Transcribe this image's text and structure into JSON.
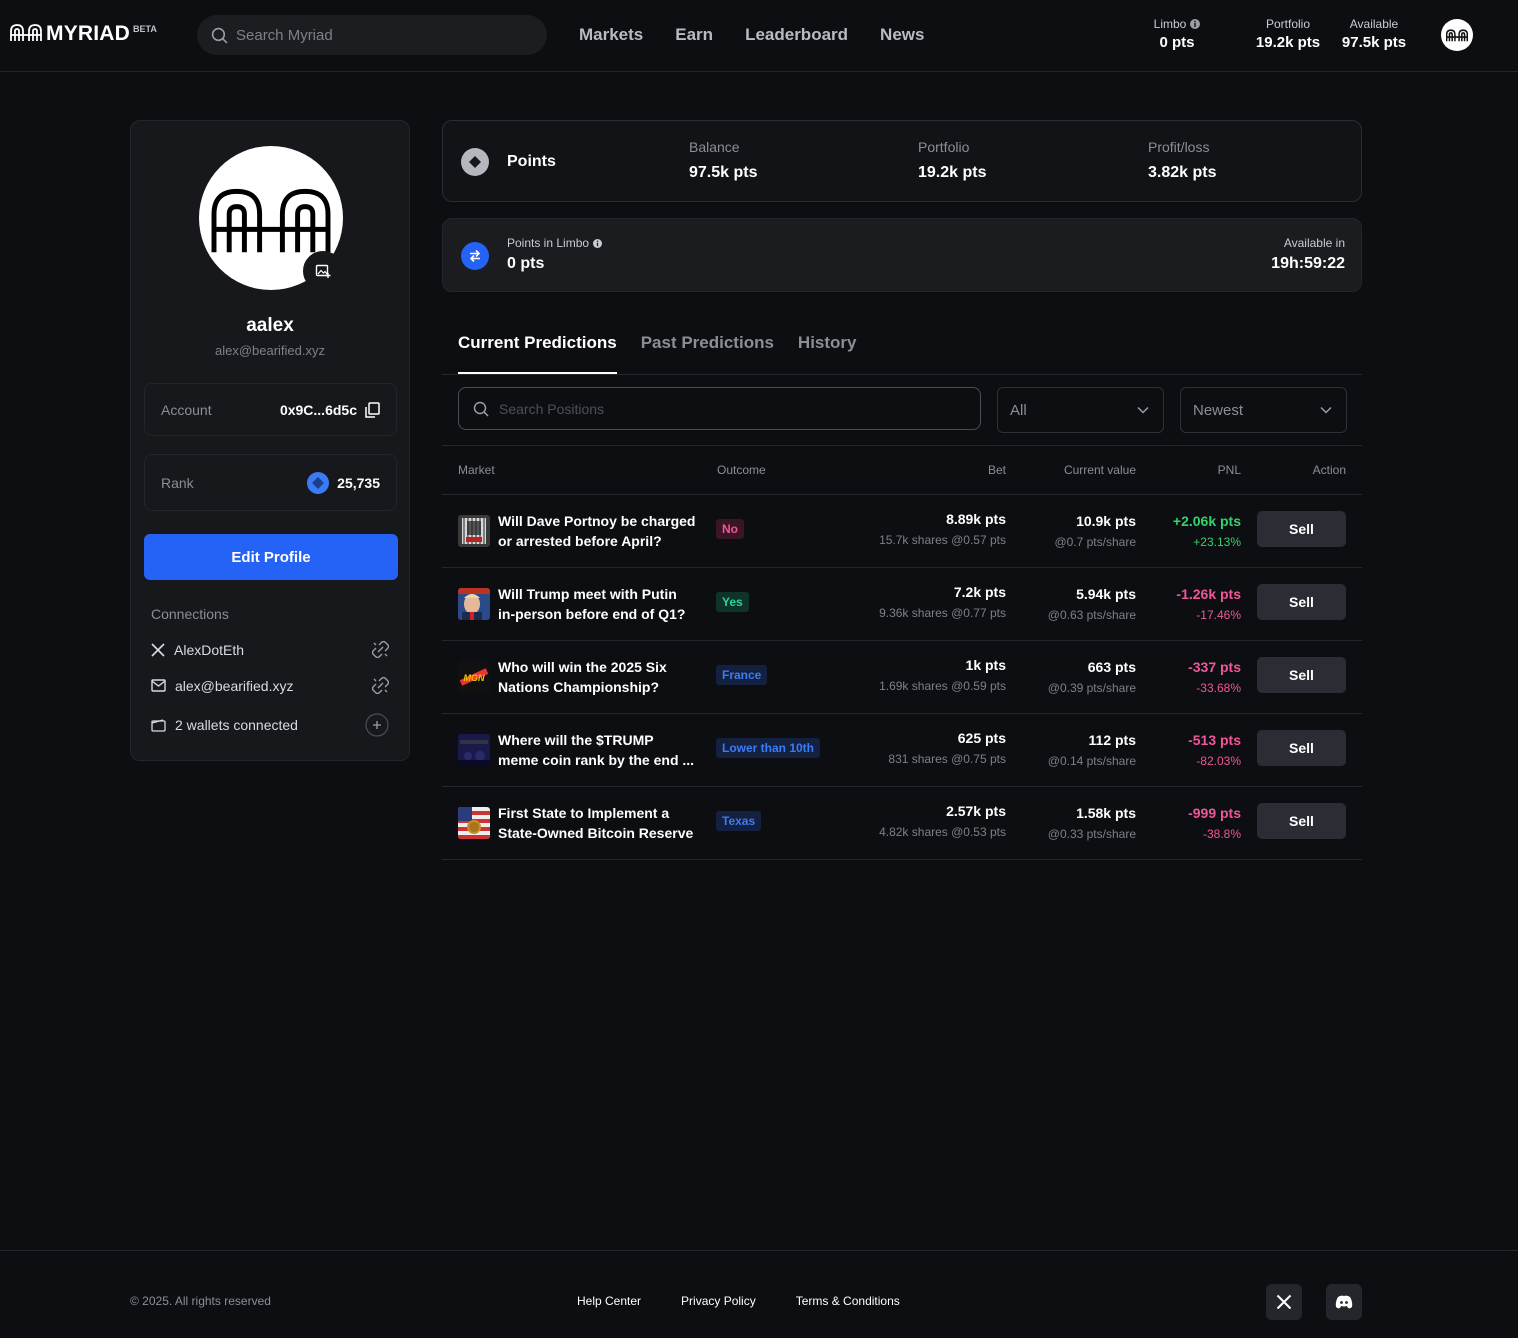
{
  "header": {
    "logo_text": "MYRIAD",
    "beta_label": "BETA",
    "search_placeholder": "Search Myriad",
    "nav": [
      "Markets",
      "Earn",
      "Leaderboard",
      "News"
    ],
    "stats": {
      "limbo": {
        "label": "Limbo",
        "value": "0 pts"
      },
      "portfolio": {
        "label": "Portfolio",
        "value": "19.2k pts"
      },
      "available": {
        "label": "Available",
        "value": "97.5k pts"
      }
    }
  },
  "profile": {
    "username": "aalex",
    "email": "alex@bearified.xyz",
    "account_label": "Account",
    "account_value": "0x9C...6d5c",
    "rank_label": "Rank",
    "rank_value": "25,735",
    "edit_button": "Edit Profile",
    "connections_title": "Connections",
    "connections": [
      {
        "icon": "x-logo-icon",
        "label": "AlexDotEth",
        "action_icon": "unlink-icon"
      },
      {
        "icon": "mail-icon",
        "label": "alex@bearified.xyz",
        "action_icon": "unlink-icon"
      },
      {
        "icon": "wallet-icon",
        "label": "2 wallets connected",
        "action_icon": "plus-icon"
      }
    ]
  },
  "points": {
    "title": "Points",
    "balance_label": "Balance",
    "balance_value": "97.5k pts",
    "portfolio_label": "Portfolio",
    "portfolio_value": "19.2k pts",
    "profit_label": "Profit/loss",
    "profit_value": "3.82k pts"
  },
  "limbo": {
    "label": "Points in Limbo",
    "value": "0 pts",
    "available_label": "Available in",
    "available_value": "19h:59:22"
  },
  "tabs": [
    "Current Predictions",
    "Past Predictions",
    "History"
  ],
  "filters": {
    "search_placeholder": "Search Positions",
    "status_value": "All",
    "sort_value": "Newest"
  },
  "table": {
    "headers": {
      "market": "Market",
      "outcome": "Outcome",
      "bet": "Bet",
      "current": "Current value",
      "pnl": "PNL",
      "action": "Action"
    },
    "rows": [
      {
        "title1": "Will Dave Portnoy be charged",
        "title2": "or arrested before April?",
        "outcome": "No",
        "outcome_style": "no",
        "bet": "8.89k pts",
        "bet_sub": "15.7k shares @0.57 pts",
        "current": "10.9k pts",
        "current_sub": "@0.7 pts/share",
        "pnl": "+2.06k pts",
        "pnl_pct": "+23.13%",
        "pnl_sign": "pos",
        "action": "Sell"
      },
      {
        "title1": "Will Trump meet with Putin",
        "title2": "in-person before end of Q1?",
        "outcome": "Yes",
        "outcome_style": "yes",
        "bet": "7.2k pts",
        "bet_sub": "9.36k shares @0.77 pts",
        "current": "5.94k pts",
        "current_sub": "@0.63 pts/share",
        "pnl": "-1.26k pts",
        "pnl_pct": "-17.46%",
        "pnl_sign": "neg",
        "action": "Sell"
      },
      {
        "title1": "Who will win the 2025 Six",
        "title2": "Nations Championship?",
        "outcome": "France",
        "outcome_style": "blue",
        "bet": "1k pts",
        "bet_sub": "1.69k shares @0.59 pts",
        "current": "663 pts",
        "current_sub": "@0.39 pts/share",
        "pnl": "-337 pts",
        "pnl_pct": "-33.68%",
        "pnl_sign": "neg",
        "action": "Sell"
      },
      {
        "title1": "Where will the $TRUMP",
        "title2": "meme coin rank by the end ...",
        "outcome": "Lower than 10th",
        "outcome_style": "blue",
        "bet": "625 pts",
        "bet_sub": "831 shares @0.75 pts",
        "current": "112 pts",
        "current_sub": "@0.14 pts/share",
        "pnl": "-513 pts",
        "pnl_pct": "-82.03%",
        "pnl_sign": "neg",
        "action": "Sell"
      },
      {
        "title1": "First State to Implement a",
        "title2": "State-Owned Bitcoin Reserve",
        "outcome": "Texas",
        "outcome_style": "blue",
        "bet": "2.57k pts",
        "bet_sub": "4.82k shares @0.53 pts",
        "current": "1.58k pts",
        "current_sub": "@0.33 pts/share",
        "pnl": "-999 pts",
        "pnl_pct": "-38.8%",
        "pnl_sign": "neg",
        "action": "Sell"
      }
    ]
  },
  "footer": {
    "copyright": "© 2025. All rights reserved",
    "links": [
      "Help Center",
      "Privacy Policy",
      "Terms & Conditions"
    ],
    "social_icons": [
      "x-logo-icon",
      "discord-icon"
    ]
  },
  "colors": {
    "accent": "#2563f6",
    "positive": "#34d26a",
    "negative": "#f0569a",
    "background": "#0d0e11"
  }
}
